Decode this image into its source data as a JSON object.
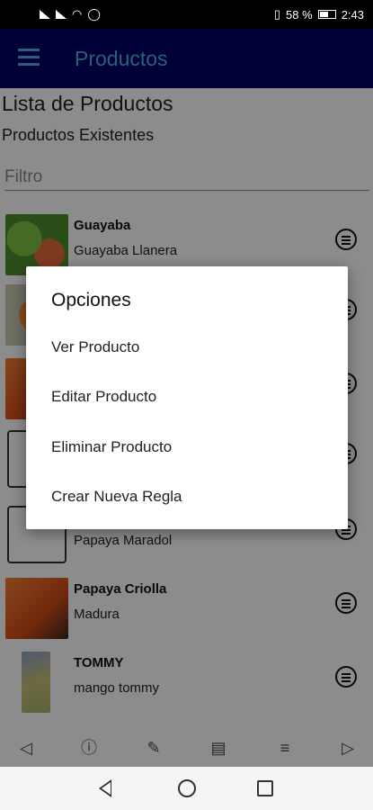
{
  "status_bar": {
    "battery_percent": "58 %",
    "time": "2:43"
  },
  "app_bar": {
    "title": "Productos"
  },
  "page": {
    "list_title": "Lista de Productos",
    "list_subtitle": "Productos Existentes",
    "filter_placeholder": "Filtro"
  },
  "products": [
    {
      "name": "Guayaba",
      "description": "Guayaba Llanera",
      "thumbnail": "guava-photo"
    },
    {
      "name": "",
      "description": "",
      "thumbnail": "papaya-photo"
    },
    {
      "name": "",
      "description": "",
      "thumbnail": "papaya-photo"
    },
    {
      "name": "",
      "description": "",
      "thumbnail": "cash-icon"
    },
    {
      "name": "",
      "description": "Papaya Maradol",
      "thumbnail": "cash-icon"
    },
    {
      "name": "Papaya Criolla",
      "description": "Madura",
      "thumbnail": "papaya-photo"
    },
    {
      "name": "TOMMY",
      "description": "mango tommy",
      "thumbnail": "mango-photo"
    }
  ],
  "dialog": {
    "title": "Opciones",
    "options": [
      "Ver Producto",
      "Editar Producto",
      "Eliminar Producto",
      "Crear Nueva Regla"
    ]
  },
  "toolbar": {
    "icons": [
      "back-arrow-icon",
      "info-icon",
      "edit-icon",
      "paste-icon",
      "menu-icon",
      "forward-arrow-icon"
    ]
  },
  "colors": {
    "app_bar": "#000066",
    "accent": "#48b3d4"
  }
}
